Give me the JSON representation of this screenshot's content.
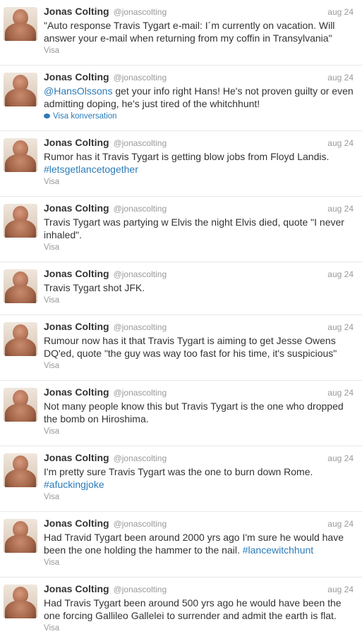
{
  "author": {
    "name": "Jonas Colting",
    "handle": "@jonascolting"
  },
  "tweets": [
    {
      "date": "aug 24",
      "text": "\"Auto response Travis Tygart e-mail: I´m currently on vacation. Will answer your e-mail when returning from my coffin in Transylvania\"",
      "action": "Visa"
    },
    {
      "date": "aug 24",
      "mention": "@HansOlssons",
      "text": " get your info right Hans! He's not proven guilty or even admitting doping, he's just tired of the whitchhunt!",
      "action": "Visa konversation"
    },
    {
      "date": "aug 24",
      "text": "Rumor has it Travis Tygart is getting blow jobs from Floyd Landis.",
      "hashtag": "#letsgetlancetogether",
      "action": "Visa"
    },
    {
      "date": "aug 24",
      "text": "Travis Tygart was partying w Elvis the night Elvis died, quote \"I never inhaled\".",
      "action": "Visa"
    },
    {
      "date": "aug 24",
      "text": "Travis Tygart shot JFK.",
      "action": "Visa"
    },
    {
      "date": "aug 24",
      "text": "Rumour now has it that Travis Tygart is aiming to get Jesse Owens DQ'ed, quote \"the guy was way too fast for his time, it's suspicious\"",
      "action": "Visa"
    },
    {
      "date": "aug 24",
      "text": "Not many people know this but Travis Tygart is the one who dropped the bomb on Hiroshima.",
      "action": "Visa"
    },
    {
      "date": "aug 24",
      "text": "I'm pretty sure Travis Tygart was the one to burn down Rome.",
      "hashtag": "#afuckingjoke",
      "action": "Visa"
    },
    {
      "date": "aug 24",
      "text": "Had Travid Tygart been around 2000 yrs ago I'm sure he would have been the one holding the hammer to the nail. ",
      "hashtag": "#lancewitchhunt",
      "action": "Visa"
    },
    {
      "date": "aug 24",
      "text": "Had Travis Tygart been around 500 yrs ago he would have been the one forcing Gallileo Gallelei to surrender and admit the earth is flat.",
      "action": "Visa"
    }
  ]
}
